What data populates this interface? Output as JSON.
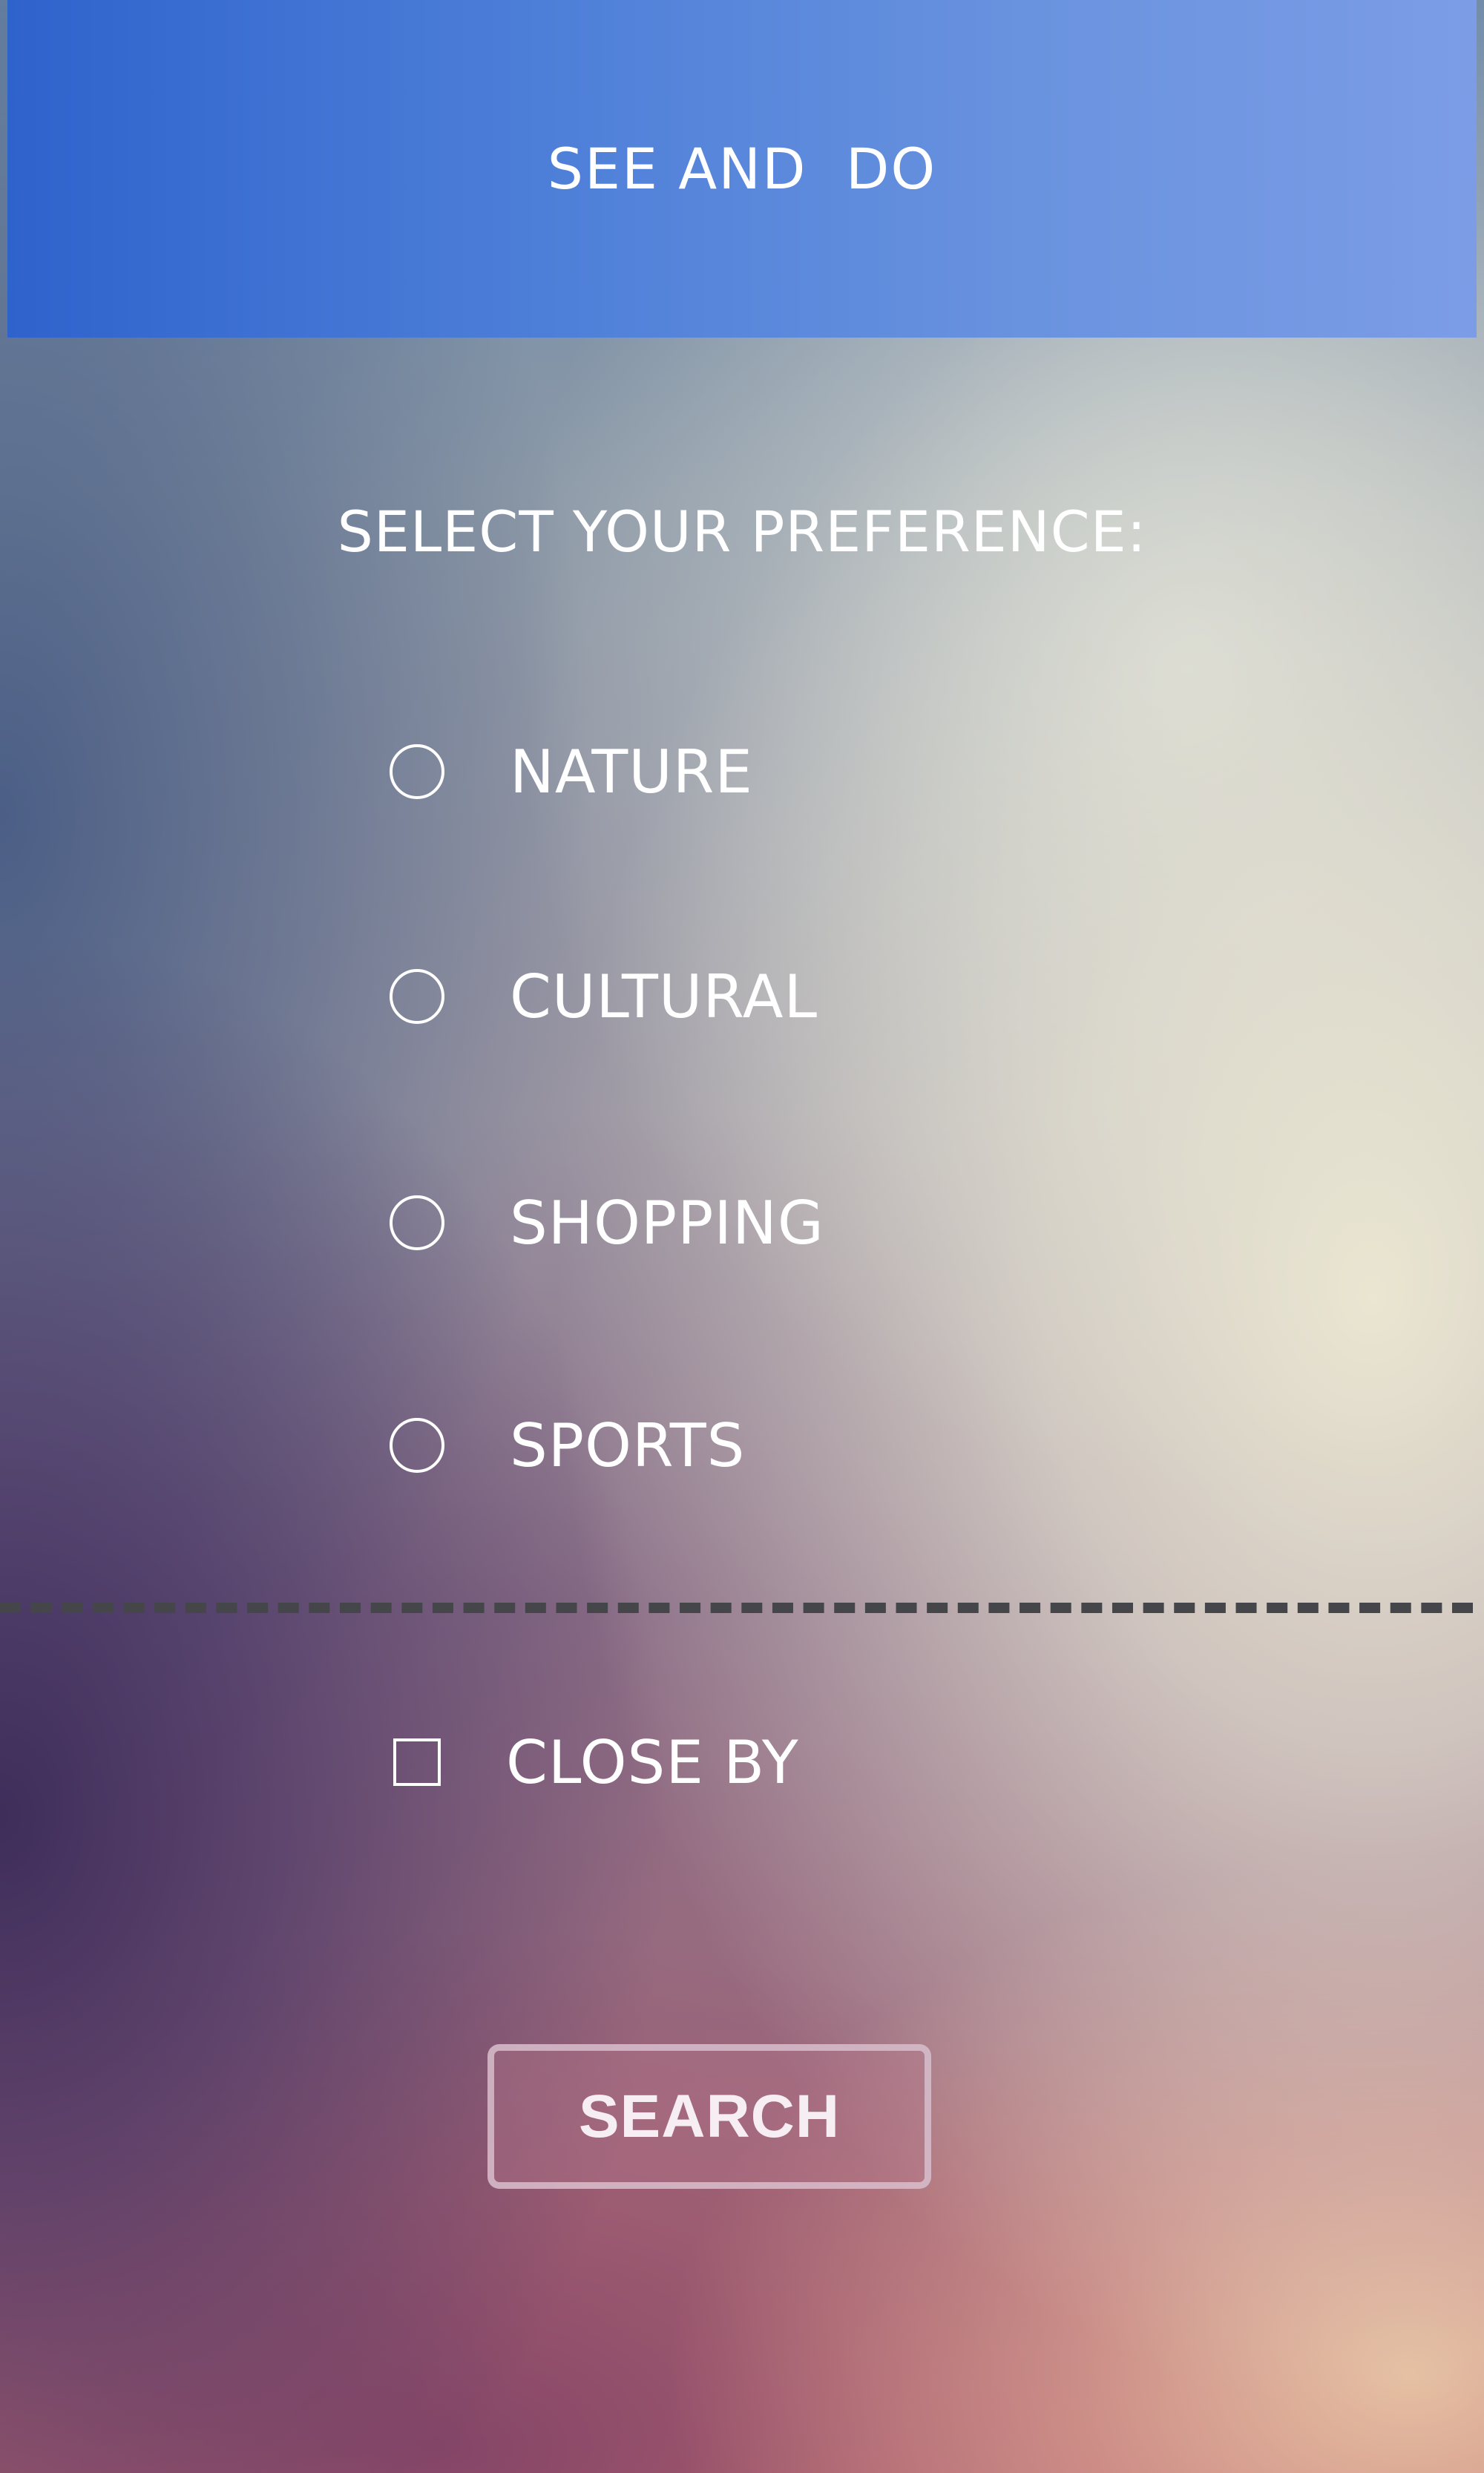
{
  "header": {
    "title": "SEE AND  DO"
  },
  "prompt": {
    "text": "SELECT YOUR PREFERENCE:"
  },
  "preferences": [
    {
      "label": "NATURE",
      "selected": false
    },
    {
      "label": "CULTURAL",
      "selected": false
    },
    {
      "label": "SHOPPING",
      "selected": false
    },
    {
      "label": "SPORTS",
      "selected": false
    }
  ],
  "close_by": {
    "label": "CLOSE BY",
    "checked": false
  },
  "search_button": {
    "label": "SEARCH"
  },
  "colors": {
    "header_start": "#2f63cc",
    "header_end": "#7c9ce6",
    "divider": "#45464a",
    "text": "#ffffff"
  }
}
